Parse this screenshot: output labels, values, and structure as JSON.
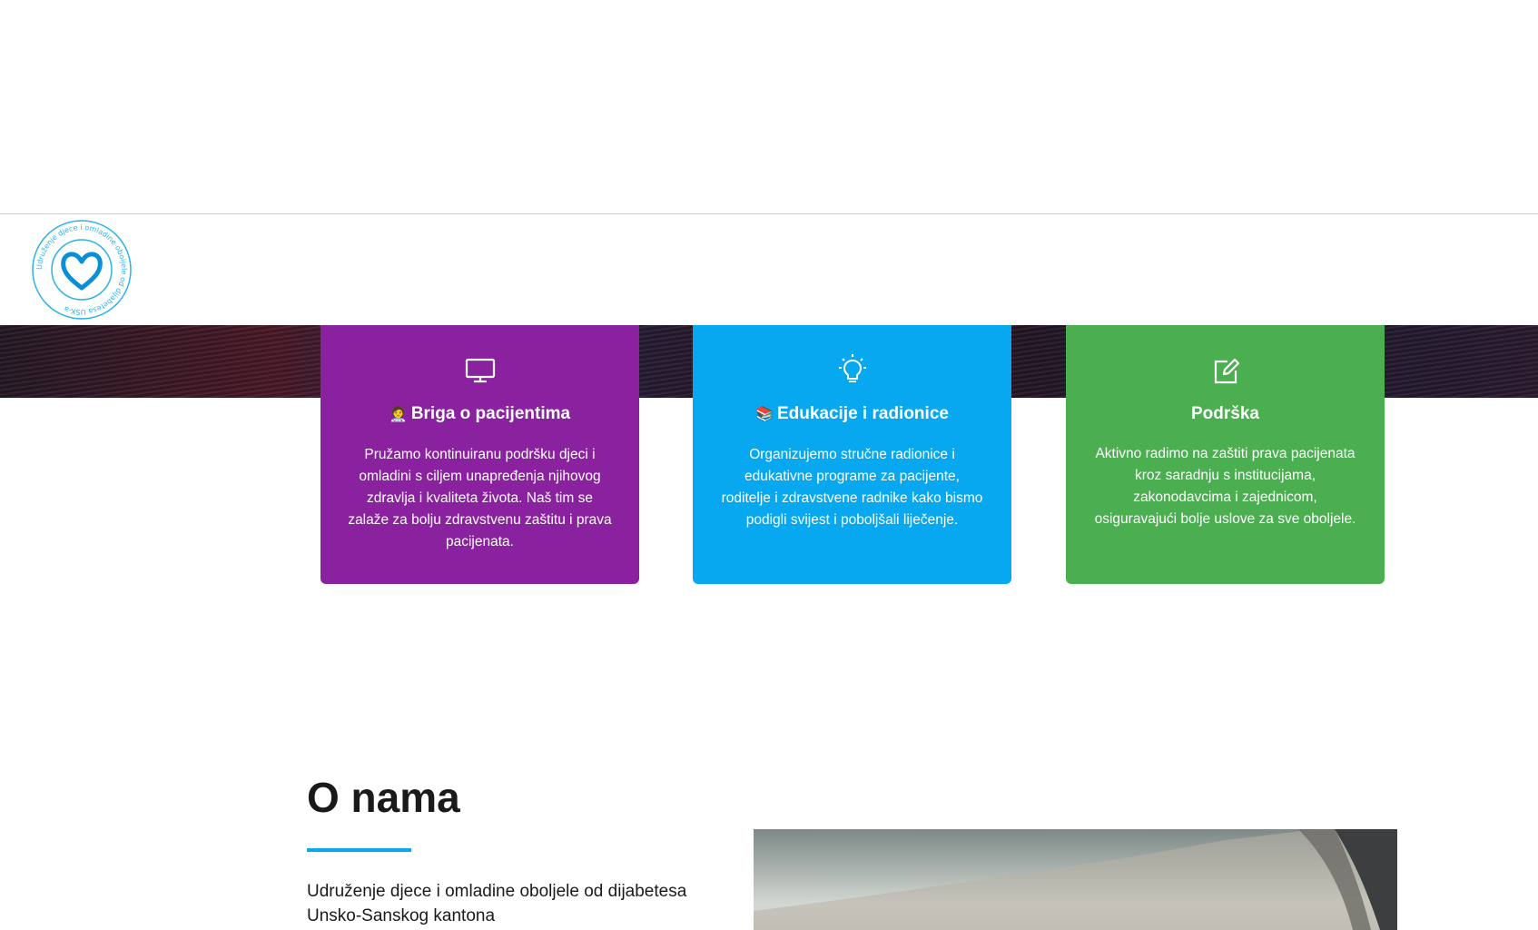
{
  "logo": {
    "ring_text": "Udruženje djece i omladine oboljele od dijabetesa USK-a",
    "colors": {
      "ring": "#2bb3e8",
      "heart": "#0a8fd6"
    }
  },
  "cards": [
    {
      "icon": "monitor-icon",
      "emoji": "🧑‍⚕️",
      "title": "Briga o pacijentima",
      "text": "Pružamo kontinuiranu podršku djeci i omladini s ciljem unapređenja njihovog zdravlja i kvaliteta života. Naš tim se zalaže za bolju zdravstvenu zaštitu i prava pacijenata.",
      "color": "#8a229f"
    },
    {
      "icon": "lightbulb-icon",
      "emoji": "📚",
      "title": "Edukacije i radionice",
      "text": "Organizujemo stručne radionice i edukativne programe za pacijente, roditelje i zdravstvene radnike kako bismo podigli svijest i poboljšali liječenje.",
      "color": "#07a8ef"
    },
    {
      "icon": "edit-icon",
      "emoji": "",
      "title": "Podrška",
      "text": "Aktivno radimo na zaštiti prava pacijenata kroz saradnju s institucijama, zakonodavcima i zajednicom, osiguravajući bolje uslove za sve oboljele.",
      "color": "#4bae50"
    }
  ],
  "about": {
    "title": "O nama",
    "text": "Udruženje djece i omladine oboljele od dijabetesa Unsko-Sanskog kantona",
    "accent_color": "#07a8ef"
  }
}
